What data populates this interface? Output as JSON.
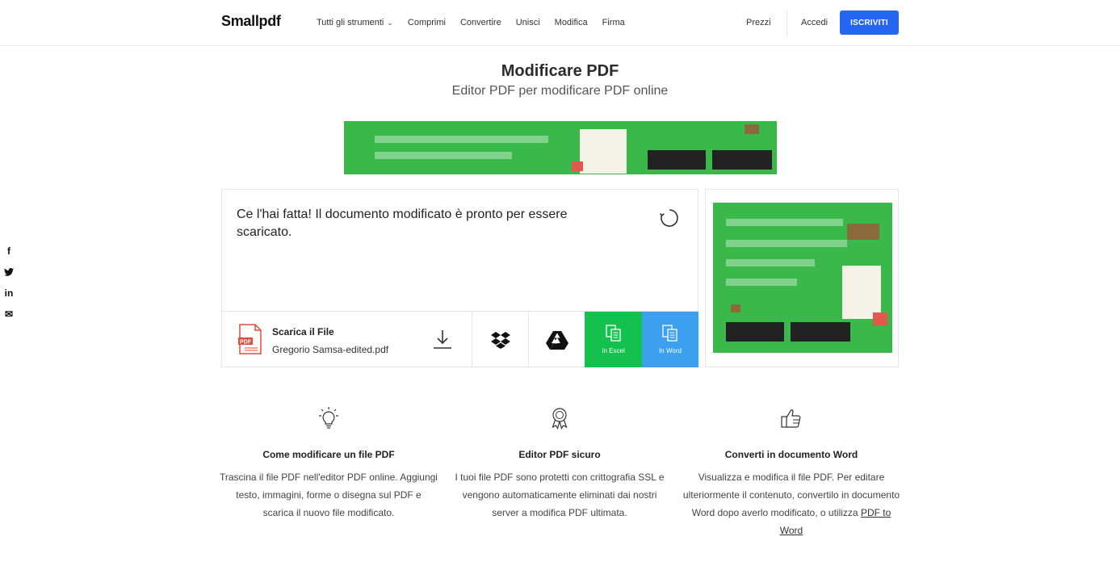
{
  "header": {
    "logo": "Smallpdf",
    "nav": [
      {
        "label": "Tutti gli strumenti"
      },
      {
        "label": "Comprimi"
      },
      {
        "label": "Convertire"
      },
      {
        "label": "Unisci"
      },
      {
        "label": "Modifica"
      },
      {
        "label": "Firma"
      }
    ],
    "prezzi": "Prezzi",
    "accedi": "Accedi",
    "signup": "ISCRIVITI"
  },
  "hero": {
    "title": "Modificare PDF",
    "subtitle": "Editor PDF per modificare PDF online"
  },
  "result": {
    "message": "Ce l'hai fatta! Il documento modificato è pronto per essere scaricato.",
    "download_title": "Scarica il File",
    "file_name": "Gregorio Samsa-edited.pdf",
    "excel_label": "In Excel",
    "word_label": "In Word"
  },
  "social": {
    "facebook": "f",
    "twitter": "t",
    "linkedin": "in",
    "email": "✉"
  },
  "features": [
    {
      "title": "Come modificare un file PDF",
      "text": "Trascina il file PDF nell'editor PDF online. Aggiungi testo, immagini, forme o disegna sul PDF e scarica il nuovo file modificato.",
      "icon": "lightbulb-icon"
    },
    {
      "title": "Editor PDF sicuro",
      "text": "I tuoi file PDF sono protetti con crittografia SSL e vengono automaticamente eliminati dai nostri server a modifica PDF ultimata.",
      "icon": "award-icon"
    },
    {
      "title": "Converti in documento Word",
      "text": "Visualizza e modifica il file PDF. Per editare ulteriormente il contenuto, convertilo in documento Word dopo averlo modificato, o utilizza",
      "link": "PDF to Word",
      "icon": "thumbs-up-icon"
    }
  ],
  "colors": {
    "accent": "#2567f2",
    "excel": "#14c14f",
    "word": "#3d9ff0",
    "ad_green": "#3bb84a"
  }
}
